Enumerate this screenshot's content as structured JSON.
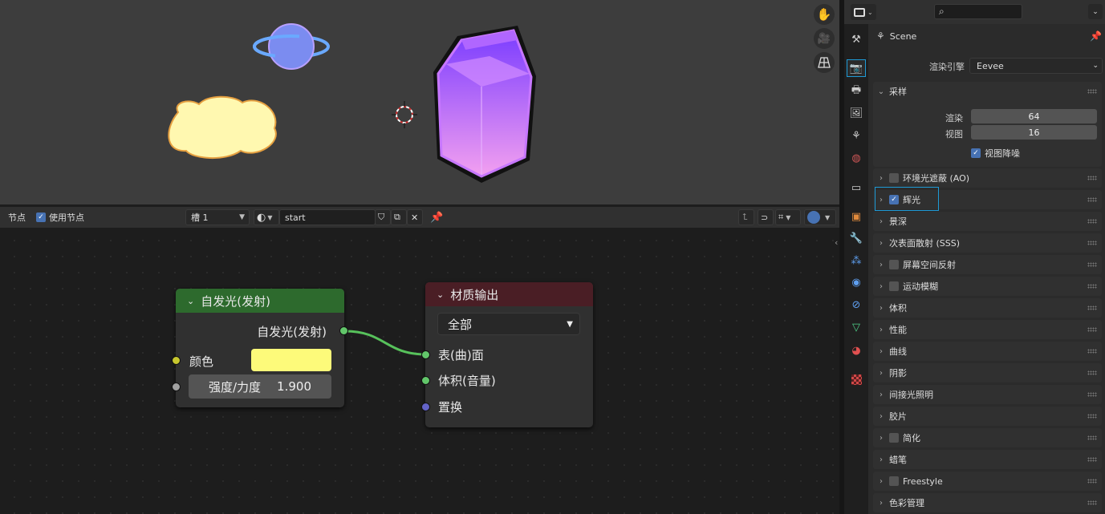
{
  "node_editor": {
    "header": {
      "menu": "节点",
      "use_nodes_label": "使用节点",
      "slot": "槽 1",
      "material_name": "start"
    },
    "emission_node": {
      "title": "自发光(发射)",
      "output": "自发光(发射)",
      "color_label": "颜色",
      "color_value": "#fdfa7a",
      "strength_label": "强度/力度",
      "strength_value": "1.900",
      "header_color": "#2d6a2d"
    },
    "output_node": {
      "title": "材质输出",
      "target": "全部",
      "inputs": [
        "表(曲)面",
        "体积(音量)",
        "置换"
      ],
      "header_color": "#4a1e25"
    }
  },
  "properties": {
    "breadcrumb": "Scene",
    "render_engine_label": "渲染引擎",
    "render_engine": "Eevee",
    "sampling": {
      "title": "采样",
      "render_label": "渲染",
      "render_value": "64",
      "viewport_label": "视图",
      "viewport_value": "16",
      "denoise_label": "视图降噪"
    },
    "panels": [
      {
        "label": "环境光遮蔽 (AO)",
        "checkbox": "off"
      },
      {
        "label": "辉光",
        "checkbox": "on"
      },
      {
        "label": "景深",
        "checkbox": "none"
      },
      {
        "label": "次表面散射 (SSS)",
        "checkbox": "none"
      },
      {
        "label": "屏幕空间反射",
        "checkbox": "off"
      },
      {
        "label": "运动模糊",
        "checkbox": "off"
      },
      {
        "label": "体积",
        "checkbox": "none"
      },
      {
        "label": "性能",
        "checkbox": "none"
      },
      {
        "label": "曲线",
        "checkbox": "none"
      },
      {
        "label": "阴影",
        "checkbox": "none"
      },
      {
        "label": "间接光照明",
        "checkbox": "none"
      },
      {
        "label": "胶片",
        "checkbox": "none"
      },
      {
        "label": "简化",
        "checkbox": "off"
      },
      {
        "label": "蜡笔",
        "checkbox": "none"
      },
      {
        "label": "Freestyle",
        "checkbox": "off"
      },
      {
        "label": "色彩管理",
        "checkbox": "none"
      }
    ],
    "highlight_color": "#1e9ad6"
  }
}
